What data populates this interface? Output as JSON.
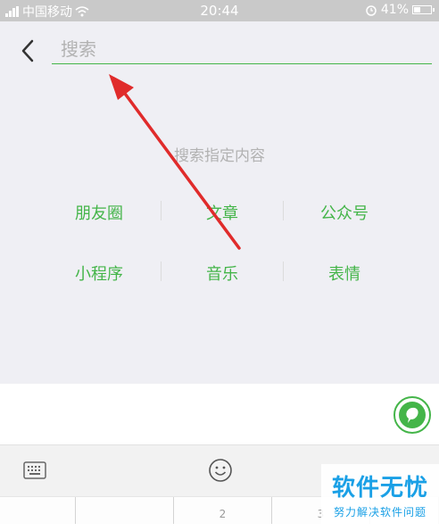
{
  "status_bar": {
    "carrier": "中国移动",
    "time": "20:44",
    "battery": "41%",
    "battery_level": 0.41
  },
  "search": {
    "placeholder": "搜索"
  },
  "content": {
    "hint": "搜索指定内容",
    "categories": [
      "朋友圈",
      "文章",
      "公众号",
      "小程序",
      "音乐",
      "表情"
    ]
  },
  "keyboard": {
    "keys": [
      "",
      "",
      "2",
      "3",
      ""
    ]
  },
  "watermark": {
    "title": "软件无忧",
    "subtitle": "努力解决软件问题"
  },
  "colors": {
    "accent": "#44b549",
    "annotation_arrow": "#e02b2b",
    "watermark": "#1aa0e6"
  },
  "icons": [
    "signal-icon",
    "wifi-icon",
    "alarm-icon",
    "battery-icon",
    "back-arrow-icon",
    "microphone-icon",
    "keyboard-icon",
    "emoji-icon"
  ]
}
